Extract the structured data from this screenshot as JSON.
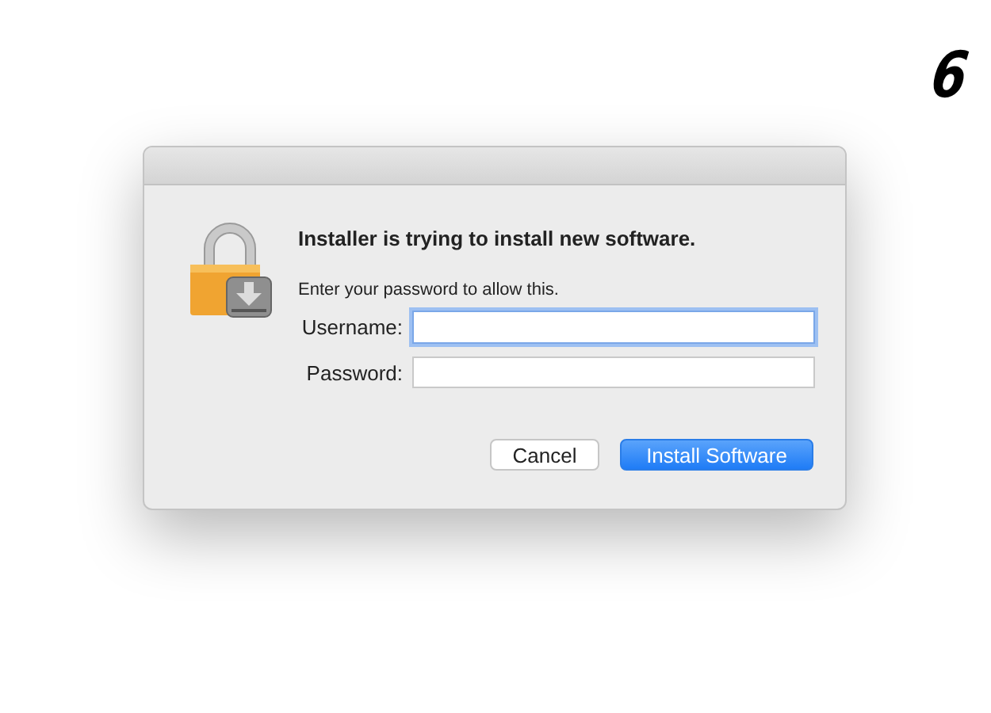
{
  "step": "6",
  "dialog": {
    "heading": "Installer is trying to install new software.",
    "message": "Enter your password to allow this.",
    "fields": [
      {
        "label": "Username:",
        "focused": true
      },
      {
        "label": "Password:",
        "focused": false
      }
    ],
    "buttons": [
      {
        "label": "Cancel",
        "kind": "normal"
      },
      {
        "label": "Install Software",
        "kind": "default"
      }
    ]
  }
}
